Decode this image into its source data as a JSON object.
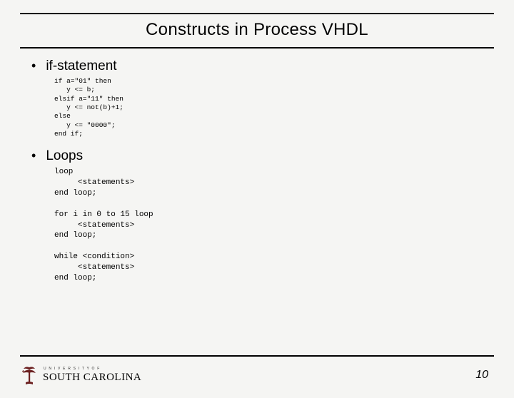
{
  "title": "Constructs in Process VHDL",
  "bullets": [
    {
      "heading": "if-statement",
      "code": "if a=\"01\" then\n   y <= b;\nelsif a=\"11\" then\n   y <= not(b)+1;\nelse\n   y <= \"0000\";\nend if;"
    },
    {
      "heading": "Loops",
      "code": "loop\n     <statements>\nend loop;\n\nfor i in 0 to 15 loop\n     <statements>\nend loop;\n\nwhile <condition>\n     <statements>\nend loop;"
    }
  ],
  "footer": {
    "logo_small": "U N I V E R S I T Y  O F",
    "logo_big": "SOUTH CAROLINA",
    "page": "10"
  }
}
